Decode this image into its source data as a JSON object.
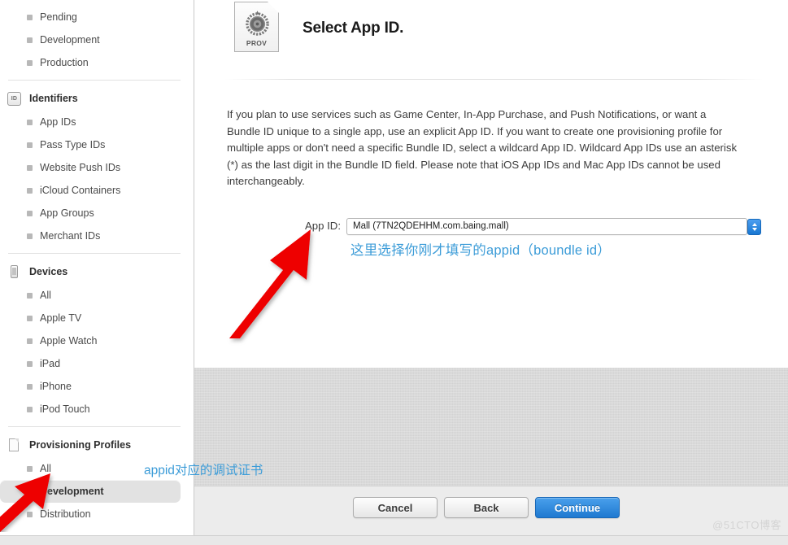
{
  "sidebar": {
    "top_items": [
      {
        "label": "Pending",
        "selected": false
      },
      {
        "label": "Development",
        "selected": false
      },
      {
        "label": "Production",
        "selected": false
      }
    ],
    "groups": [
      {
        "title": "Identifiers",
        "icon": "id-badge-icon",
        "icon_text": "ID",
        "items": [
          {
            "label": "App IDs",
            "selected": false
          },
          {
            "label": "Pass Type IDs",
            "selected": false
          },
          {
            "label": "Website Push IDs",
            "selected": false
          },
          {
            "label": "iCloud Containers",
            "selected": false
          },
          {
            "label": "App Groups",
            "selected": false
          },
          {
            "label": "Merchant IDs",
            "selected": false
          }
        ]
      },
      {
        "title": "Devices",
        "icon": "device-icon",
        "icon_text": "",
        "items": [
          {
            "label": "All",
            "selected": false
          },
          {
            "label": "Apple TV",
            "selected": false
          },
          {
            "label": "Apple Watch",
            "selected": false
          },
          {
            "label": "iPad",
            "selected": false
          },
          {
            "label": "iPhone",
            "selected": false
          },
          {
            "label": "iPod Touch",
            "selected": false
          }
        ]
      },
      {
        "title": "Provisioning Profiles",
        "icon": "document-icon",
        "icon_text": "",
        "items": [
          {
            "label": "All",
            "selected": false
          },
          {
            "label": "Development",
            "selected": true
          },
          {
            "label": "Distribution",
            "selected": false
          }
        ]
      }
    ]
  },
  "main": {
    "icon_label": "PROV",
    "title": "Select App ID.",
    "description": "If you plan to use services such as Game Center, In-App Purchase, and Push Notifications, or want a Bundle ID unique to a single app, use an explicit App ID. If you want to create one provisioning profile for multiple apps or don't need a specific Bundle ID, select a wildcard App ID. Wildcard App IDs use an asterisk (*) as the last digit in the Bundle ID field. Please note that iOS App IDs and Mac App IDs cannot be used interchangeably.",
    "form": {
      "app_id_label": "App ID:",
      "app_id_value": "Mall (7TN2QDEHHM.com.baing.mall)",
      "app_id_options": [
        "Mall (7TN2QDEHHM.com.baing.mall)"
      ]
    },
    "buttons": {
      "cancel": "Cancel",
      "back": "Back",
      "continue": "Continue"
    }
  },
  "annotations": {
    "app_id_note": "这里选择你刚才填写的appid（boundle id）",
    "cert_note": "appid对应的调试证书",
    "note_color": "#3c9cd8",
    "arrow_color": "#ee0000"
  },
  "watermark": "@51CTO博客"
}
